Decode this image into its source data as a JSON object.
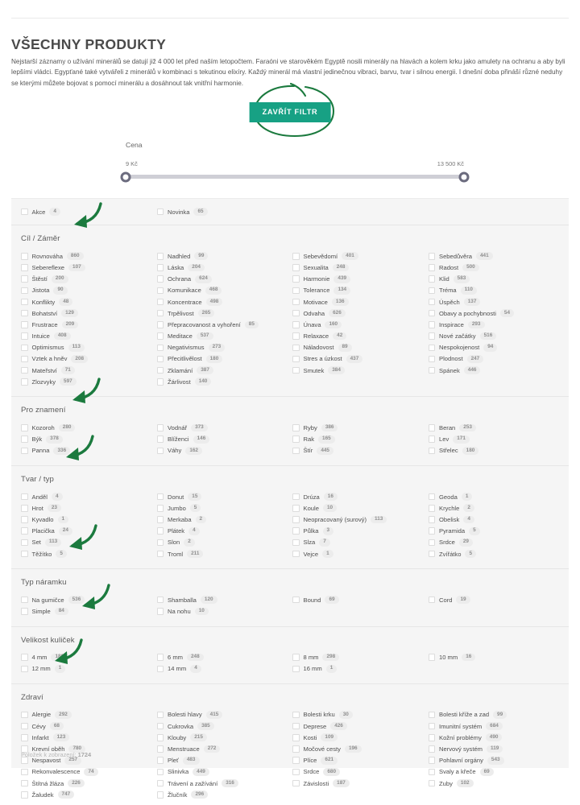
{
  "header": {
    "title": "VŠECHNY PRODUKTY",
    "intro": "Nejstarší záznamy o užívání minerálů se datují již 4 000 let před naším letopočtem. Faraóni ve starověkém Egyptě nosili minerály na hlavách a kolem krku jako amulety na ochranu a aby byli lepšími vládci. Egypťané také vytvářeli z minerálů v kombinaci s tekutinou elixíry. Každý minerál má vlastní jedinečnou vibraci, barvu, tvar i silnou energii. I dnešní doba přináší různé neduhy se kterými můžete bojovat s pomocí minerálu a dosáhnout tak vnitřní harmonie."
  },
  "toolbar": {
    "close_filter_label": "ZAVŘÍT FILTR",
    "accent_color": "#17a184",
    "annotation_color": "#1b7a3e"
  },
  "price_slider": {
    "label": "Cena",
    "min_label": "9 Kč",
    "max_label": "13 500 Kč",
    "min_position_percent": 0,
    "max_position_percent": 100,
    "handle_color": "#6b6b7e",
    "track_color": "#cfcfd6"
  },
  "filters": {
    "top_row": {
      "title": "",
      "columns": [
        [
          {
            "label": "Akce",
            "count": "4"
          }
        ],
        [
          {
            "label": "Novinka",
            "count": "65"
          }
        ],
        [],
        []
      ]
    },
    "sections": [
      {
        "title": "Cíl / Záměr",
        "columns": [
          [
            {
              "label": "Rovnováha",
              "count": "860"
            },
            {
              "label": "Sebereflexe",
              "count": "107"
            },
            {
              "label": "Štěstí",
              "count": "200"
            },
            {
              "label": "Jistota",
              "count": "90"
            },
            {
              "label": "Konflikty",
              "count": "48"
            },
            {
              "label": "Bohatství",
              "count": "129"
            },
            {
              "label": "Frustrace",
              "count": "209"
            },
            {
              "label": "Intuice",
              "count": "408"
            },
            {
              "label": "Optimismus",
              "count": "113"
            },
            {
              "label": "Vztek a hněv",
              "count": "208"
            },
            {
              "label": "Mateřství",
              "count": "71"
            },
            {
              "label": "Zlozvyky",
              "count": "597"
            }
          ],
          [
            {
              "label": "Nadhled",
              "count": "99"
            },
            {
              "label": "Láska",
              "count": "204"
            },
            {
              "label": "Ochrana",
              "count": "624"
            },
            {
              "label": "Komunikace",
              "count": "468"
            },
            {
              "label": "Koncentrace",
              "count": "498"
            },
            {
              "label": "Trpělivost",
              "count": "265"
            },
            {
              "label": "Přepracovanost a vyhoření",
              "count": "85"
            },
            {
              "label": "Meditace",
              "count": "537"
            },
            {
              "label": "Negativismus",
              "count": "273"
            },
            {
              "label": "Přecitlivělost",
              "count": "180"
            },
            {
              "label": "Zklamání",
              "count": "387"
            },
            {
              "label": "Žárlivost",
              "count": "140"
            }
          ],
          [
            {
              "label": "Sebevědomí",
              "count": "401"
            },
            {
              "label": "Sexualita",
              "count": "248"
            },
            {
              "label": "Harmonie",
              "count": "439"
            },
            {
              "label": "Tolerance",
              "count": "134"
            },
            {
              "label": "Motivace",
              "count": "136"
            },
            {
              "label": "Odvaha",
              "count": "626"
            },
            {
              "label": "Únava",
              "count": "160"
            },
            {
              "label": "Relaxace",
              "count": "42"
            },
            {
              "label": "Náladovost",
              "count": "89"
            },
            {
              "label": "Stres a úzkost",
              "count": "437"
            },
            {
              "label": "Smutek",
              "count": "384"
            }
          ],
          [
            {
              "label": "Sebedůvěra",
              "count": "441"
            },
            {
              "label": "Radost",
              "count": "500"
            },
            {
              "label": "Klid",
              "count": "583"
            },
            {
              "label": "Tréma",
              "count": "110"
            },
            {
              "label": "Úspěch",
              "count": "137"
            },
            {
              "label": "Obavy a pochybnosti",
              "count": "54"
            },
            {
              "label": "Inspirace",
              "count": "293"
            },
            {
              "label": "Nové začátky",
              "count": "516"
            },
            {
              "label": "Nespokojenost",
              "count": "94"
            },
            {
              "label": "Plodnost",
              "count": "247"
            },
            {
              "label": "Spánek",
              "count": "446"
            }
          ]
        ]
      },
      {
        "title": "Pro znamení",
        "columns": [
          [
            {
              "label": "Kozoroh",
              "count": "280"
            },
            {
              "label": "Býk",
              "count": "378"
            },
            {
              "label": "Panna",
              "count": "336"
            }
          ],
          [
            {
              "label": "Vodnář",
              "count": "373"
            },
            {
              "label": "Blíženci",
              "count": "146"
            },
            {
              "label": "Váhy",
              "count": "162"
            }
          ],
          [
            {
              "label": "Ryby",
              "count": "386"
            },
            {
              "label": "Rak",
              "count": "165"
            },
            {
              "label": "Štír",
              "count": "445"
            }
          ],
          [
            {
              "label": "Beran",
              "count": "253"
            },
            {
              "label": "Lev",
              "count": "171"
            },
            {
              "label": "Střelec",
              "count": "180"
            }
          ]
        ]
      },
      {
        "title": "Tvar / typ",
        "columns": [
          [
            {
              "label": "Anděl",
              "count": "4"
            },
            {
              "label": "Hrot",
              "count": "23"
            },
            {
              "label": "Kyvadlo",
              "count": "1"
            },
            {
              "label": "Placička",
              "count": "24"
            },
            {
              "label": "Set",
              "count": "113"
            },
            {
              "label": "Těžítko",
              "count": "5"
            }
          ],
          [
            {
              "label": "Donut",
              "count": "15"
            },
            {
              "label": "Jumbo",
              "count": "5"
            },
            {
              "label": "Merkaba",
              "count": "2"
            },
            {
              "label": "Plátek",
              "count": "4"
            },
            {
              "label": "Slon",
              "count": "2"
            },
            {
              "label": "Troml",
              "count": "211"
            }
          ],
          [
            {
              "label": "Drúza",
              "count": "16"
            },
            {
              "label": "Koule",
              "count": "10"
            },
            {
              "label": "Neopracovaný (surový)",
              "count": "113"
            },
            {
              "label": "Půlka",
              "count": "3"
            },
            {
              "label": "Slza",
              "count": "7"
            },
            {
              "label": "Vejce",
              "count": "1"
            }
          ],
          [
            {
              "label": "Geoda",
              "count": "1"
            },
            {
              "label": "Krychle",
              "count": "2"
            },
            {
              "label": "Obelisk",
              "count": "4"
            },
            {
              "label": "Pyramida",
              "count": "5"
            },
            {
              "label": "Srdce",
              "count": "29"
            },
            {
              "label": "Zvířátko",
              "count": "5"
            }
          ]
        ]
      },
      {
        "title": "Typ náramku",
        "columns": [
          [
            {
              "label": "Na gumičce",
              "count": "536"
            },
            {
              "label": "Simple",
              "count": "84"
            }
          ],
          [
            {
              "label": "Shamballa",
              "count": "120"
            },
            {
              "label": "Na nohu",
              "count": "10"
            }
          ],
          [
            {
              "label": "Bound",
              "count": "69"
            }
          ],
          [
            {
              "label": "Cord",
              "count": "19"
            }
          ]
        ]
      },
      {
        "title": "Velikost kuliček",
        "columns": [
          [
            {
              "label": "4 mm",
              "count": "180"
            },
            {
              "label": "12 mm",
              "count": "1"
            }
          ],
          [
            {
              "label": "6 mm",
              "count": "248"
            },
            {
              "label": "14 mm",
              "count": "4"
            }
          ],
          [
            {
              "label": "8 mm",
              "count": "298"
            },
            {
              "label": "16 mm",
              "count": "1"
            }
          ],
          [
            {
              "label": "10 mm",
              "count": "16"
            }
          ]
        ]
      },
      {
        "title": "Zdraví",
        "columns": [
          [
            {
              "label": "Alergie",
              "count": "292"
            },
            {
              "label": "Cévy",
              "count": "68"
            },
            {
              "label": "Infarkt",
              "count": "123"
            },
            {
              "label": "Krevní oběh",
              "count": "780"
            },
            {
              "label": "Nespavost",
              "count": "257"
            },
            {
              "label": "Rekonvalescence",
              "count": "74"
            },
            {
              "label": "Štítná žláza",
              "count": "226"
            },
            {
              "label": "Žaludek",
              "count": "747"
            }
          ],
          [
            {
              "label": "Bolesti hlavy",
              "count": "415"
            },
            {
              "label": "Cukrovka",
              "count": "385"
            },
            {
              "label": "Klouby",
              "count": "215"
            },
            {
              "label": "Menstruace",
              "count": "272"
            },
            {
              "label": "Pleť",
              "count": "483"
            },
            {
              "label": "Slinivka",
              "count": "449"
            },
            {
              "label": "Trávení a zažívání",
              "count": "316"
            },
            {
              "label": "Žlučník",
              "count": "296"
            }
          ],
          [
            {
              "label": "Bolesti krku",
              "count": "30"
            },
            {
              "label": "Deprese",
              "count": "426"
            },
            {
              "label": "Kosti",
              "count": "109"
            },
            {
              "label": "Močové cesty",
              "count": "196"
            },
            {
              "label": "Plíce",
              "count": "621"
            },
            {
              "label": "Srdce",
              "count": "680"
            },
            {
              "label": "Závislosti",
              "count": "187"
            }
          ],
          [
            {
              "label": "Bolesti kříže a zad",
              "count": "99"
            },
            {
              "label": "Imunitní systém",
              "count": "684"
            },
            {
              "label": "Kožní problémy",
              "count": "490"
            },
            {
              "label": "Nervový systém",
              "count": "119"
            },
            {
              "label": "Pohlavní orgány",
              "count": "543"
            },
            {
              "label": "Svaly a křeče",
              "count": "69"
            },
            {
              "label": "Zuby",
              "count": "102"
            }
          ]
        ]
      }
    ],
    "footer_prefix": "Položek k zobrazení: ",
    "footer_count": "1724"
  }
}
